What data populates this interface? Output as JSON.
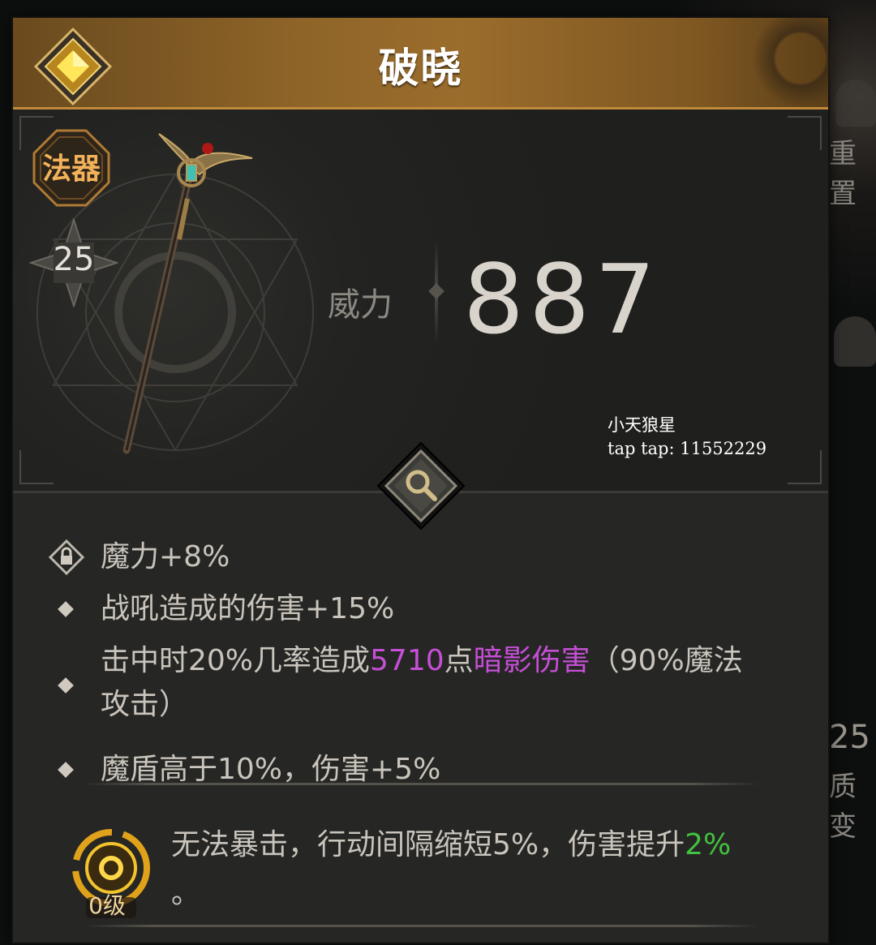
{
  "item": {
    "name": "破晓",
    "type_label": "法器",
    "level": "25",
    "power_label": "威力",
    "power_value": "887"
  },
  "watermark": {
    "line1": "小天狼星",
    "line2": "tap tap: 11552229"
  },
  "stats": [
    {
      "icon": "lock-icon",
      "text": "魔力+8%"
    },
    {
      "icon": "diamond-bullet-icon",
      "text": "战吼造成的伤害+15%"
    },
    {
      "icon": "diamond-bullet-icon",
      "part1": "击中时20%几率造成",
      "highlight_value": "5710",
      "part2": "点",
      "highlight_type": "暗影伤害",
      "part3": "（90%魔法",
      "line2": "攻击）"
    },
    {
      "icon": "diamond-bullet-icon",
      "text": "魔盾高于10%，伤害+5%"
    }
  ],
  "skill": {
    "level_label": "0级",
    "text_main": "无法暴击，行动间隔缩短5%，伤害提升",
    "highlight": "2%",
    "text_end": "。"
  },
  "side_panel": {
    "reset_label": "重置",
    "level_value": "25",
    "evolve_label": "质变"
  },
  "colors": {
    "header_gold": "#8e6428",
    "highlight_purple": "#c54fd6",
    "highlight_green": "#41c13f",
    "type_orange": "#f3b25a"
  }
}
